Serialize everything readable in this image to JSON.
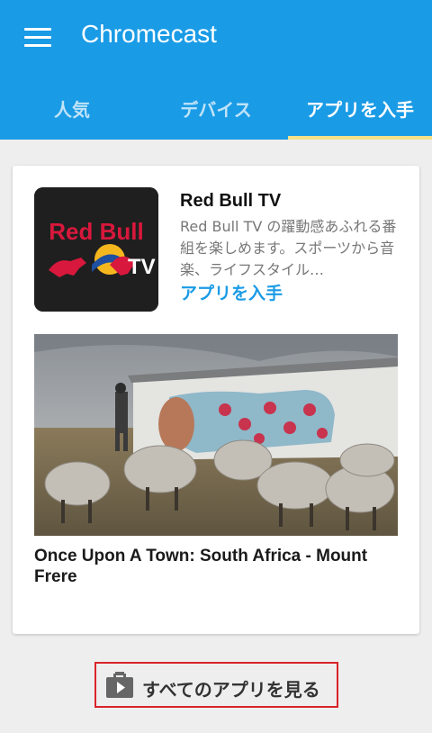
{
  "app_bar": {
    "title": "Chromecast",
    "menu_icon": "hamburger-menu-icon",
    "color": "#1a9be6"
  },
  "tabs": [
    {
      "label": "人気",
      "active": false
    },
    {
      "label": "デバイス",
      "active": false
    },
    {
      "label": "アプリを入手",
      "active": true
    }
  ],
  "tab_indicator_color": "#f6e08a",
  "card": {
    "app_name": "Red Bull TV",
    "app_description": "Red Bull TV の躍動感あふれる番組を楽しめます。スポーツから音楽、ライフスタイル…",
    "get_app_label": "アプリを入手",
    "icon_text": {
      "brand": "Red Bull",
      "tv": "TV"
    },
    "video_title": "Once Upon A Town: South Africa - Mount Frere"
  },
  "see_all": {
    "label": "すべてのアプリを見る",
    "icon": "play-store-bag-icon",
    "highlight_color": "#d9232a"
  }
}
